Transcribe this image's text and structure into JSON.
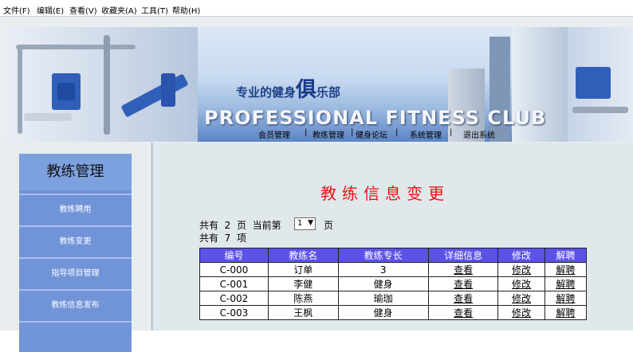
{
  "menu": [
    "文件(F)",
    "编辑(E)",
    "查看(V)",
    "收藏夹(A)",
    "工具(T)",
    "帮助(H)"
  ],
  "banner": {
    "slogan_pre": "专业的健身",
    "slogan_big": "俱",
    "slogan_post": "乐部",
    "club_name": "PROFESSIONAL FITNESS CLUB"
  },
  "nav": [
    "会员管理",
    "|",
    "教练管理",
    "|",
    "健身论坛",
    "|",
    "系统管理",
    "|",
    "退出系统"
  ],
  "sidebar": {
    "title": "教练管理",
    "items": [
      "教练聘用",
      "教练变更",
      "指导项目管理",
      "教练信息发布"
    ]
  },
  "main": {
    "title": "教练信息变更",
    "pages_prefix": "共有",
    "pages_count": "2",
    "pages_unit": "页",
    "current_prefix": "当前第",
    "current_page": "1",
    "current_unit": "页",
    "items_prefix": "共有",
    "items_count": "7",
    "items_unit": "项"
  },
  "table": {
    "headers": [
      "编号",
      "教练名",
      "教练专长",
      "详细信息",
      "修改",
      "解聘"
    ],
    "rows": [
      [
        "C-000",
        "订单",
        "3",
        "查看",
        "修改",
        "解聘"
      ],
      [
        "C-001",
        "李健",
        "健身",
        "查看",
        "修改",
        "解聘"
      ],
      [
        "C-002",
        "陈燕",
        "瑜珈",
        "查看",
        "修改",
        "解聘"
      ],
      [
        "C-003",
        "王枫",
        "健身",
        "查看",
        "修改",
        "解聘"
      ]
    ]
  },
  "colors": {
    "title_red": "#ee1111",
    "table_header": "#5c52e8",
    "sidebar_blue": "#7194d8",
    "link_blue": "#1a33c8"
  }
}
